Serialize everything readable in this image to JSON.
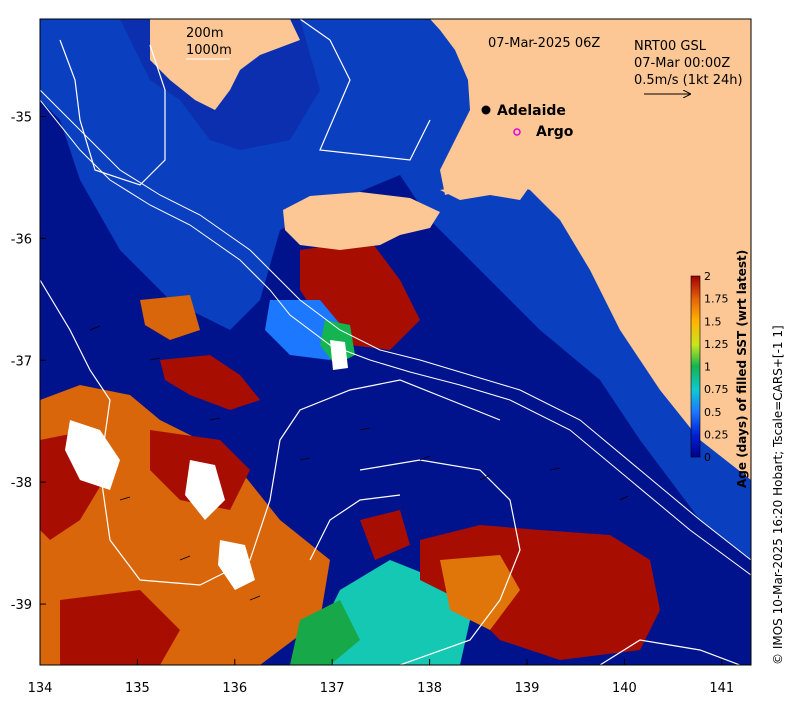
{
  "timestamp": "07-Mar-2025 06Z",
  "product": {
    "line1": "NRT00 GSL",
    "line2": "07-Mar 00:00Z",
    "scale": "0.5m/s (1kt 24h)"
  },
  "isobaths": [
    "200m",
    "1000m"
  ],
  "places": [
    {
      "name": "Adelaide",
      "lon": 138.6,
      "lat": -34.93,
      "marker": "dot"
    },
    {
      "name": "Argo",
      "lon": 138.8,
      "lat": -35.12,
      "marker": "ring"
    }
  ],
  "axes": {
    "x_ticks": [
      "134",
      "135",
      "136",
      "137",
      "138",
      "139",
      "140",
      "141"
    ],
    "y_ticks": [
      "-35",
      "-36",
      "-37",
      "-38",
      "-39"
    ],
    "lon_range": [
      134,
      141.3
    ],
    "lat_range": [
      -39.5,
      -34.2
    ]
  },
  "colorbar": {
    "title": "Age (days) of filled SST (wrt latest)",
    "ticks": [
      "0",
      "0.25",
      "0.5",
      "0.75",
      "1",
      "1.25",
      "1.5",
      "1.75",
      "2"
    ],
    "range": [
      0,
      2
    ]
  },
  "credit": "© IMOS 10-Mar-2025 16:20 Hobart; Tscale=CARS+[-1 1]",
  "colors": {
    "land": "#fcc795",
    "ocean_recent": "#00138c",
    "shelf": "#0a3fbf",
    "age_mid": "#14c8b4",
    "age_old": "#d9660a",
    "age_max": "#a80d02"
  }
}
